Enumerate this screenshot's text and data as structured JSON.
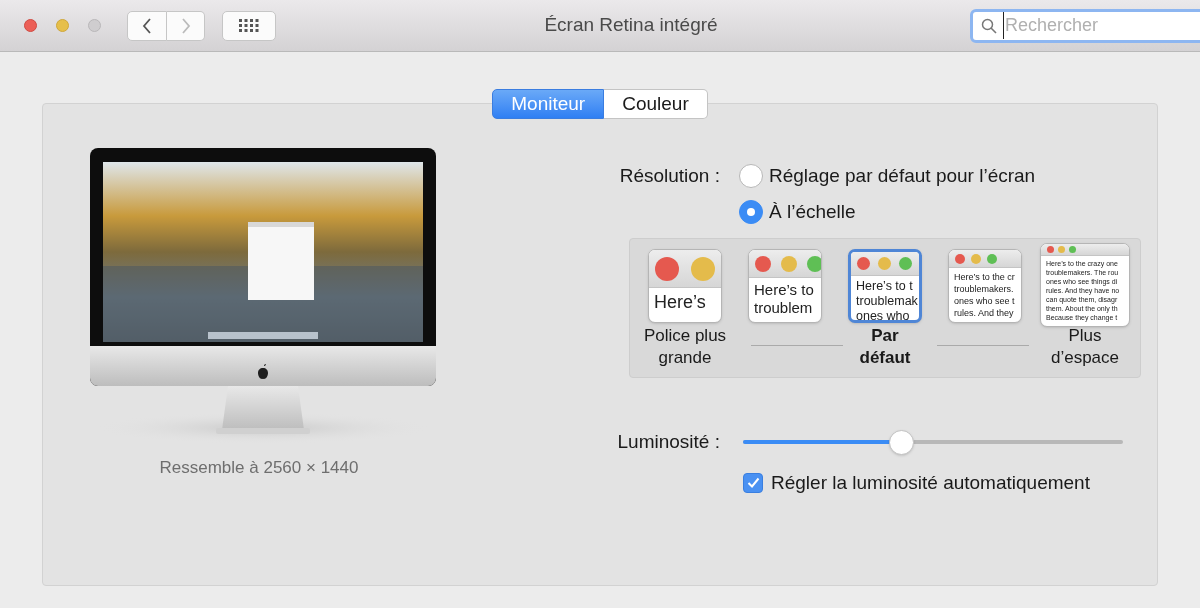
{
  "window": {
    "title": "Écran Retina intégré"
  },
  "search": {
    "placeholder": "Rechercher"
  },
  "tabs": [
    {
      "label": "Moniteur",
      "selected": true
    },
    {
      "label": "Couleur",
      "selected": false
    }
  ],
  "display": {
    "caption": "Ressemble à 2560 × 1440"
  },
  "resolution": {
    "label": "Résolution :",
    "options": [
      {
        "label": "Réglage par défaut pour l’écran",
        "selected": false
      },
      {
        "label": "À l’échelle",
        "selected": true
      }
    ]
  },
  "scales": [
    {
      "kind": "xl",
      "preview": [
        "Here’s"
      ],
      "label": [
        "Police plus",
        "grande"
      ],
      "selected": false
    },
    {
      "kind": "l",
      "preview": [
        "Here’s to",
        "troublem"
      ],
      "selected": false
    },
    {
      "kind": "m",
      "preview": [
        "Here’s to t",
        "troublemak",
        "ones who"
      ],
      "label": [
        "Par",
        "défaut"
      ],
      "selected": true
    },
    {
      "kind": "s",
      "preview": [
        "Here’s to the cr",
        "troublemakers.",
        "ones who see t",
        "rules. And they"
      ],
      "selected": false
    },
    {
      "kind": "xs",
      "preview": [
        "Here’s to the crazy one",
        "troublemakers. The rou",
        "ones who see things di",
        "rules. And they have no",
        "can quote them, disagr",
        "them. About the only th",
        "Because they change t"
      ],
      "label": [
        "Plus",
        "d’espace"
      ],
      "selected": false
    }
  ],
  "brightness": {
    "label": "Luminosité :",
    "level": 0.417
  },
  "auto_brightness": {
    "label": "Régler la luminosité automatiquement",
    "checked": true
  }
}
